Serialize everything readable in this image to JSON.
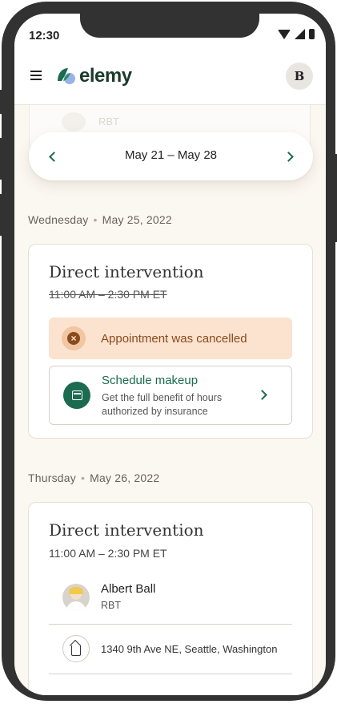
{
  "status_bar": {
    "time": "12:30"
  },
  "header": {
    "logo_text": "elemy",
    "avatar_initial": "B",
    "brand_color": "#1c6b50"
  },
  "ghost_card": {
    "role": "RBT"
  },
  "week_nav": {
    "label": "May 21 – May 28"
  },
  "days": [
    {
      "weekday": "Wednesday",
      "date": "May 25, 2022",
      "appointment": {
        "title": "Direct intervention",
        "time": "11:00 AM – 2:30 PM ET",
        "cancelled_notice": "Appointment was cancelled",
        "makeup": {
          "title": "Schedule makeup",
          "description": "Get the full benefit of hours authorized by insurance"
        }
      }
    },
    {
      "weekday": "Thursday",
      "date": "May 26, 2022",
      "appointment": {
        "title": "Direct intervention",
        "time": "11:00 AM – 2:30 PM ET",
        "provider": {
          "name": "Albert Ball",
          "role": "RBT"
        },
        "address": "1340 9th Ave NE, Seattle, Washington"
      }
    }
  ],
  "colors": {
    "cancel_bg": "#fbe3cf",
    "cancel_text": "#8a4a1c",
    "accent": "#1a6a4f",
    "screen_bg": "#fbf7f1"
  },
  "icons": [
    "menu-icon",
    "cancel-x-icon",
    "calendar-icon",
    "chevron-left-icon",
    "chevron-right-icon",
    "home-icon"
  ]
}
